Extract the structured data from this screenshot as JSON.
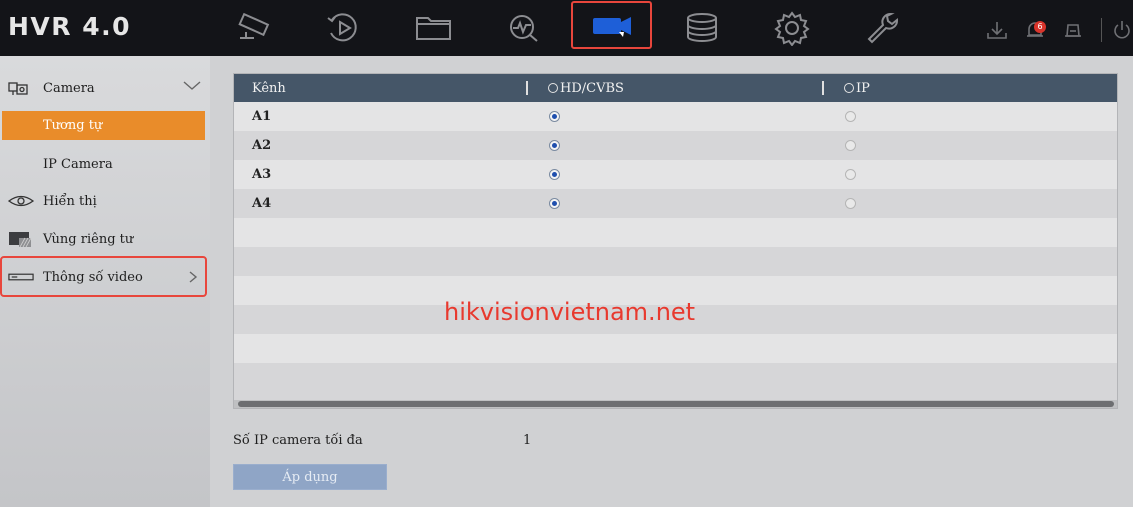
{
  "app": {
    "logo": "HVR 4.0"
  },
  "topnav": {
    "icons": [
      "live-view-camera-icon",
      "playback-icon",
      "folder-icon",
      "search-analysis-icon",
      "camera-icon",
      "storage-database-icon",
      "settings-gear-icon",
      "maintenance-wrench-icon"
    ],
    "active": "camera-icon",
    "notification_count": "6"
  },
  "sidebar": {
    "camera_label": "Camera",
    "camera_sub_selected": "Tương tự",
    "camera_sub_ip": "IP Camera",
    "display_label": "Hiển thị",
    "privacy_label": "Vùng riêng tư",
    "video_params_label": "Thông số video"
  },
  "table": {
    "headers": {
      "channel": "Kênh",
      "hd_cvbs": "HD/CVBS",
      "ip": "IP"
    },
    "rows": [
      {
        "name": "A1",
        "mode": "HD/CVBS"
      },
      {
        "name": "A2",
        "mode": "HD/CVBS"
      },
      {
        "name": "A3",
        "mode": "HD/CVBS"
      },
      {
        "name": "A4",
        "mode": "HD/CVBS"
      }
    ]
  },
  "watermark": "hikvisionvietnam.net",
  "footer": {
    "max_ip_label": "Số IP camera tối đa",
    "max_ip_value": "1",
    "apply_label": "Áp dụng"
  },
  "colors": {
    "accent_orange": "#e98c2a",
    "highlight_red": "#e8463c",
    "header_blue": "#455668",
    "active_icon_blue": "#1e5fd8"
  }
}
